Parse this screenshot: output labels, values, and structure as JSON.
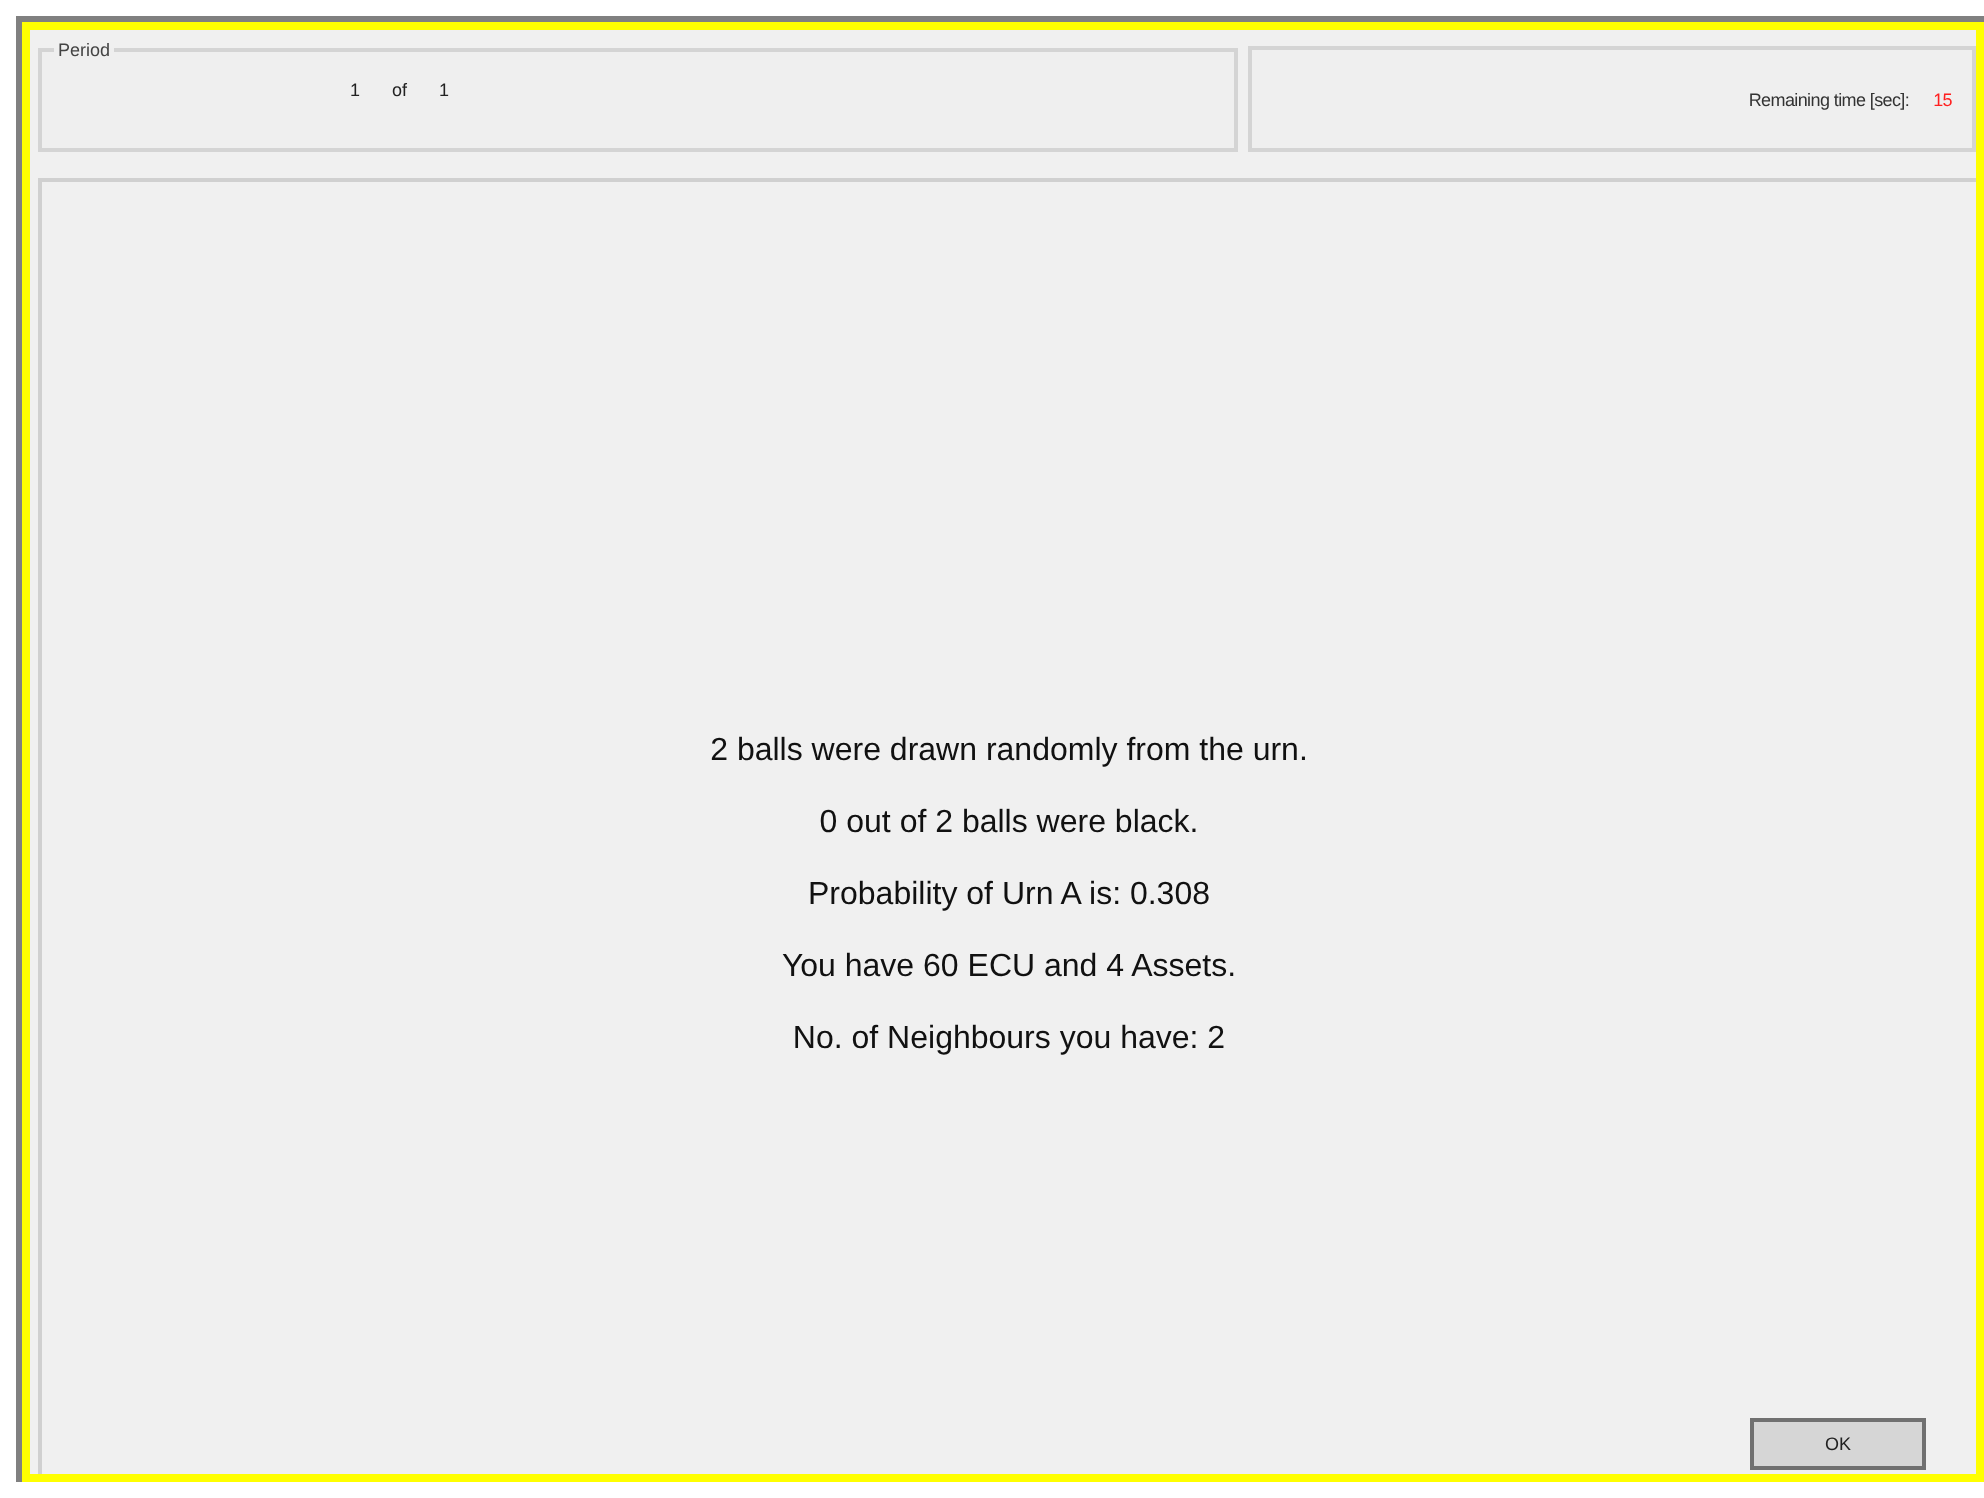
{
  "period": {
    "legend": "Period",
    "current": "1",
    "separator": "of",
    "total": "1"
  },
  "timer": {
    "label": "Remaining time [sec]:",
    "value": "15"
  },
  "messages": [
    "2 balls were drawn randomly from the urn.",
    "0 out of 2 balls were black.",
    "Probability of Urn A is: 0.308",
    "You have 60 ECU and 4 Assets.",
    "No. of Neighbours you have: 2"
  ],
  "buttons": [
    "OK"
  ]
}
